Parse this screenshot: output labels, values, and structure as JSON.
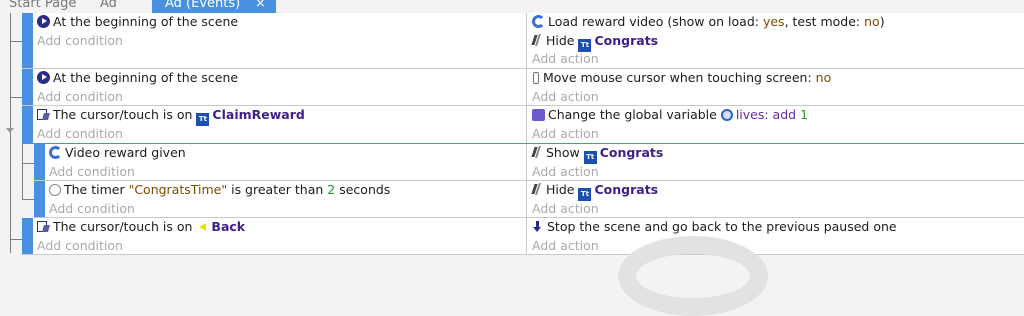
{
  "tabs": [
    {
      "label": "Start Page"
    },
    {
      "label": "Ad"
    },
    {
      "label": "Ad (Events)",
      "close": "×"
    }
  ],
  "events": [
    {
      "conditions": [
        {
          "text": "At the beginning of the scene",
          "icon": "scene-start-icon"
        }
      ],
      "add_condition": "Add condition",
      "actions": [
        {
          "prefix": "Load reward video (show on load: ",
          "p1": "yes",
          "mid": ", test mode: ",
          "p2": "no",
          "suffix": ")",
          "icon": "ad-icon"
        },
        {
          "prefix": "Hide ",
          "object": "Congrats",
          "icon": "visibility-icon"
        }
      ],
      "add_action": "Add action"
    },
    {
      "conditions": [
        {
          "text": "At the beginning of the scene",
          "icon": "scene-start-icon"
        }
      ],
      "add_condition": "Add condition",
      "actions": [
        {
          "prefix": "Move mouse cursor when touching screen: ",
          "p1": "no",
          "icon": "mouse-icon"
        }
      ],
      "add_action": "Add action"
    },
    {
      "conditions": [
        {
          "prefix": "The cursor/touch is on ",
          "object": "ClaimReward",
          "icon": "cursor-on-object-icon"
        }
      ],
      "add_condition": "Add condition",
      "actions": [
        {
          "prefix": "Change the global variable ",
          "variable": "lives",
          "op": ": add ",
          "value": "1",
          "icon": "variable-icon"
        }
      ],
      "add_action": "Add action",
      "subevents": [
        {
          "conditions": [
            {
              "text": "Video reward given",
              "icon": "ad-icon"
            }
          ],
          "add_condition": "Add condition",
          "actions": [
            {
              "prefix": "Show ",
              "object": "Congrats",
              "icon": "visibility-icon"
            }
          ],
          "add_action": "Add action"
        },
        {
          "conditions": [
            {
              "prefix": "The timer ",
              "timer": "\"CongratsTime\"",
              "mid": " is greater than ",
              "value": "2",
              "suffix": " seconds",
              "icon": "timer-icon"
            }
          ],
          "add_condition": "Add condition",
          "actions": [
            {
              "prefix": "Hide ",
              "object": "Congrats",
              "icon": "visibility-icon"
            }
          ],
          "add_action": "Add action"
        }
      ]
    },
    {
      "conditions": [
        {
          "prefix": "The cursor/touch is on ",
          "object": "Back",
          "icon": "cursor-on-object-icon"
        }
      ],
      "add_condition": "Add condition",
      "actions": [
        {
          "text": "Stop the scene and go back to the previous paused one",
          "icon": "stop-scene-icon"
        }
      ],
      "add_action": "Add action"
    }
  ],
  "colors": {
    "accent": "#4a90e2",
    "object": "#3f1f8a",
    "number": "#1a9c2a",
    "param": "#7d4a00"
  }
}
